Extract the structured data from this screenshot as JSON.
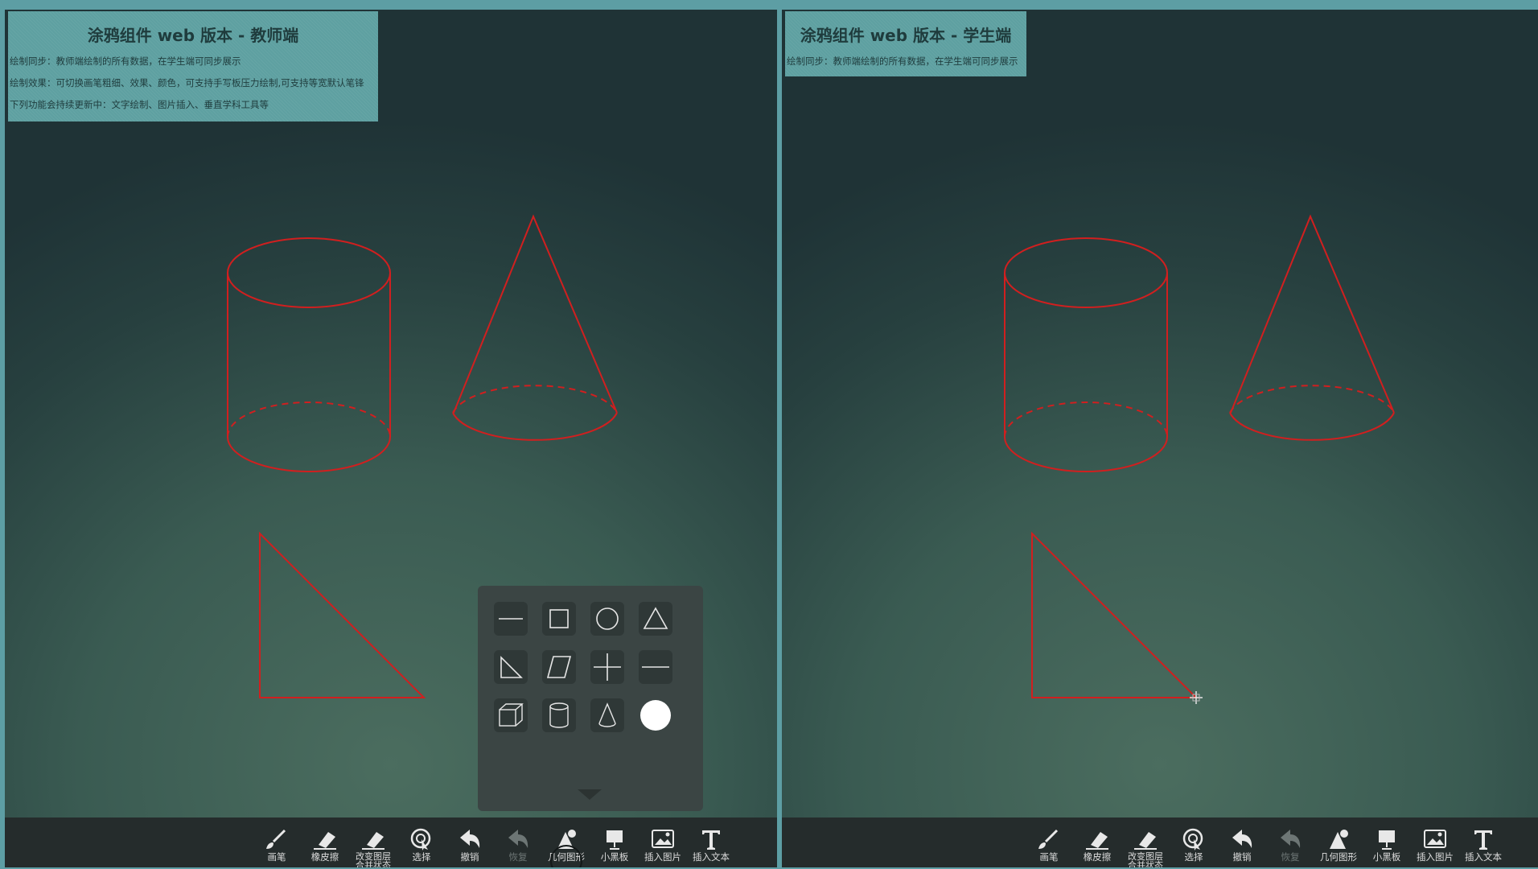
{
  "teacher": {
    "title": "涂鸦组件 web 版本 - 教师端",
    "lines": [
      "绘制同步：教师端绘制的所有数据，在学生端可同步展示",
      "绘制效果：可切换画笔粗细、效果、颜色，可支持手写板压力绘制,可支持等宽默认笔锋",
      "下列功能会持续更新中：文字绘制、图片插入、垂直学科工具等"
    ]
  },
  "student": {
    "title": "涂鸦组件 web 版本 - 学生端",
    "lines": [
      "绘制同步：教师端绘制的所有数据，在学生端可同步展示"
    ]
  },
  "toolbar": {
    "items": [
      {
        "label": "画笔",
        "icon": "brush-icon"
      },
      {
        "label": "橡皮擦",
        "icon": "eraser-icon"
      },
      {
        "label": "改变图层\n合并状态",
        "icon": "layer-eraser-icon"
      },
      {
        "label": "选择",
        "icon": "select-icon"
      },
      {
        "label": "撤销",
        "icon": "undo-icon"
      },
      {
        "label": "恢复",
        "icon": "redo-icon",
        "disabled": true
      },
      {
        "label": "几何图形",
        "icon": "geometry-icon",
        "active_in_teacher": true
      },
      {
        "label": "小黑板",
        "icon": "blackboard-icon"
      },
      {
        "label": "插入图片",
        "icon": "image-icon"
      },
      {
        "label": "插入文本",
        "icon": "text-icon"
      }
    ]
  },
  "shape_panel": {
    "shapes": [
      "line",
      "rectangle",
      "circle",
      "triangle",
      "right-triangle",
      "parallelogram",
      "axes",
      "dash-line",
      "cube",
      "cylinder",
      "cone",
      "sphere"
    ]
  },
  "colors": {
    "stroke": "#d11f1f",
    "toolbar_bg": "#252c2c",
    "info_bg": "#5ea0a1",
    "frame": "#5d9ea4"
  }
}
